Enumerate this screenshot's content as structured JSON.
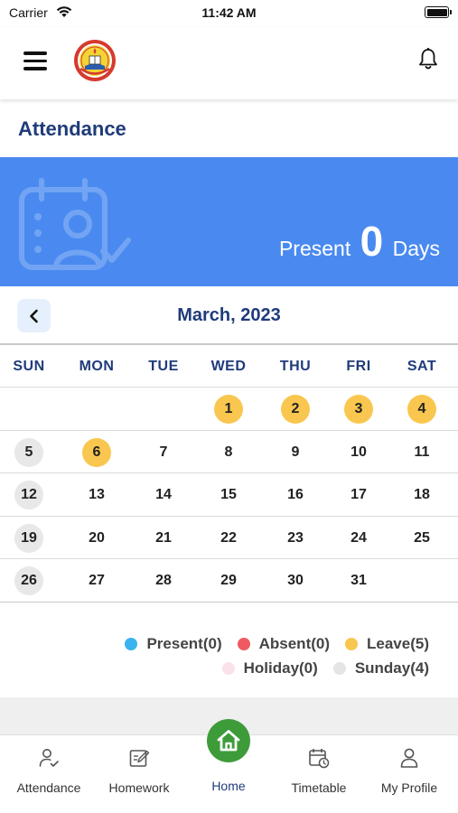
{
  "status_bar": {
    "carrier": "Carrier",
    "time": "11:42 AM"
  },
  "header": {
    "menu_icon": "hamburger-menu-icon",
    "logo": "school-logo",
    "notification_icon": "bell-icon"
  },
  "page": {
    "title": "Attendance"
  },
  "summary": {
    "label_prefix": "Present",
    "count": "0",
    "label_suffix": "Days",
    "icon": "calendar-person-icon",
    "background_color": "#4a8af0"
  },
  "month_nav": {
    "prev_icon": "chevron-left-icon",
    "title": "March, 2023"
  },
  "calendar": {
    "weekdays": [
      "SUN",
      "MON",
      "TUE",
      "WED",
      "THU",
      "FRI",
      "SAT"
    ],
    "weeks": [
      [
        null,
        null,
        null,
        {
          "d": "1",
          "s": "leave"
        },
        {
          "d": "2",
          "s": "leave"
        },
        {
          "d": "3",
          "s": "leave"
        },
        {
          "d": "4",
          "s": "leave"
        }
      ],
      [
        {
          "d": "5",
          "s": "sunday"
        },
        {
          "d": "6",
          "s": "leave"
        },
        {
          "d": "7",
          "s": ""
        },
        {
          "d": "8",
          "s": ""
        },
        {
          "d": "9",
          "s": ""
        },
        {
          "d": "10",
          "s": ""
        },
        {
          "d": "11",
          "s": ""
        }
      ],
      [
        {
          "d": "12",
          "s": "sunday"
        },
        {
          "d": "13",
          "s": ""
        },
        {
          "d": "14",
          "s": ""
        },
        {
          "d": "15",
          "s": ""
        },
        {
          "d": "16",
          "s": ""
        },
        {
          "d": "17",
          "s": ""
        },
        {
          "d": "18",
          "s": ""
        }
      ],
      [
        {
          "d": "19",
          "s": "sunday"
        },
        {
          "d": "20",
          "s": ""
        },
        {
          "d": "21",
          "s": ""
        },
        {
          "d": "22",
          "s": ""
        },
        {
          "d": "23",
          "s": ""
        },
        {
          "d": "24",
          "s": ""
        },
        {
          "d": "25",
          "s": ""
        }
      ],
      [
        {
          "d": "26",
          "s": "sunday"
        },
        {
          "d": "27",
          "s": ""
        },
        {
          "d": "28",
          "s": ""
        },
        {
          "d": "29",
          "s": ""
        },
        {
          "d": "30",
          "s": ""
        },
        {
          "d": "31",
          "s": ""
        },
        null
      ]
    ]
  },
  "legend": {
    "row1": [
      {
        "label": "Present(0)",
        "color": "#3ab3ee"
      },
      {
        "label": "Absent(0)",
        "color": "#ee5a5f"
      },
      {
        "label": "Leave(5)",
        "color": "#f9c74f"
      }
    ],
    "row2": [
      {
        "label": "Holiday(0)",
        "color": "#fbe1ea"
      },
      {
        "label": "Sunday(4)",
        "color": "#e5e5e5"
      }
    ]
  },
  "colors": {
    "accent": "#1f3b7a",
    "leave": "#f9c74f",
    "sunday": "#e8e8e8",
    "home_active": "#3e9b3a"
  },
  "bottom_nav": {
    "items": [
      {
        "label": "Attendance",
        "icon": "user-check-icon"
      },
      {
        "label": "Homework",
        "icon": "edit-note-icon"
      },
      {
        "label": "Home",
        "icon": "home-icon",
        "active": true
      },
      {
        "label": "Timetable",
        "icon": "calendar-clock-icon"
      },
      {
        "label": "My Profile",
        "icon": "user-icon"
      }
    ]
  }
}
